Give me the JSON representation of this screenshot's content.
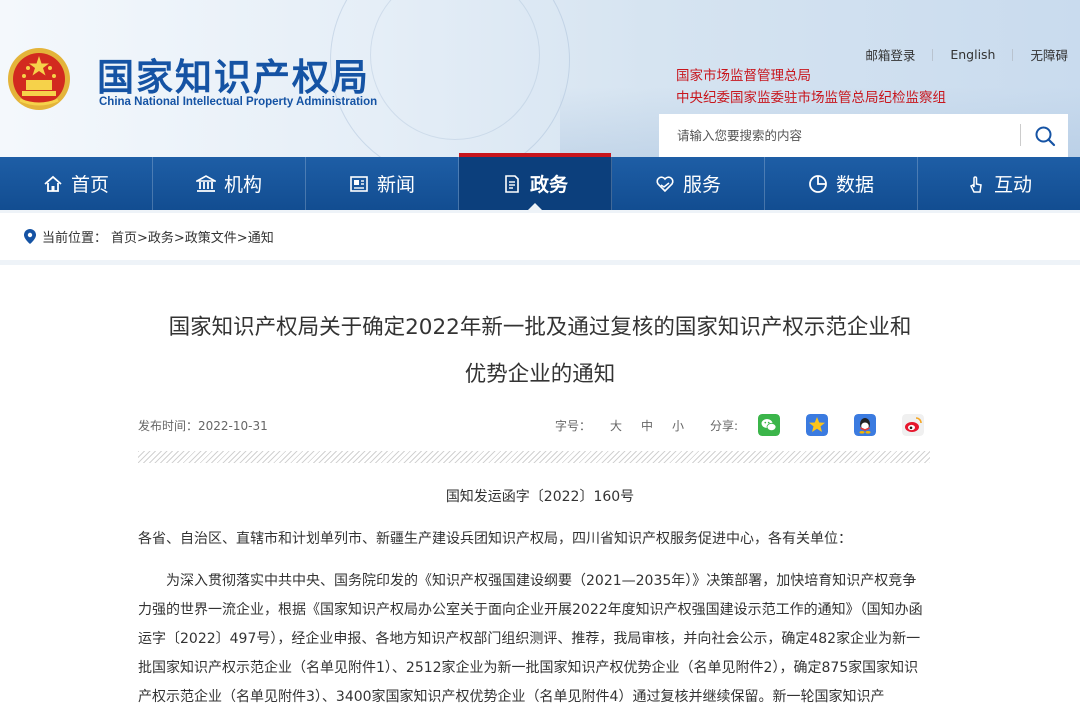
{
  "header": {
    "logo_cn": "国家知识产权局",
    "logo_en": "China National Intellectual Property Administration",
    "top_links": [
      "邮箱登录",
      "English",
      "无障碍"
    ],
    "partners": [
      "国家市场监督管理总局",
      "中央纪委国家监委驻市场监管总局纪检监察组"
    ],
    "search_placeholder": "请输入您要搜索的内容"
  },
  "nav": [
    {
      "label": "首页",
      "icon": "home-icon"
    },
    {
      "label": "机构",
      "icon": "institution-icon"
    },
    {
      "label": "新闻",
      "icon": "news-icon"
    },
    {
      "label": "政务",
      "icon": "document-icon",
      "active": true
    },
    {
      "label": "服务",
      "icon": "service-icon"
    },
    {
      "label": "数据",
      "icon": "pie-chart-icon"
    },
    {
      "label": "互动",
      "icon": "hand-touch-icon"
    }
  ],
  "breadcrumb": {
    "label": "当前位置：",
    "path": "首页>政务>政策文件>通知"
  },
  "article": {
    "title_line1": "国家知识产权局关于确定2022年新一批及通过复核的国家知识产权示范企业和",
    "title_line2": "优势企业的通知",
    "date": "发布时间：2022-10-31",
    "font_size_label": "字号：",
    "font_sizes": [
      "大",
      "中",
      "小"
    ],
    "share_label": "分享:",
    "share_icons": [
      "wechat-icon",
      "qzone-icon",
      "qq-icon",
      "weibo-icon"
    ],
    "doc_number": "国知发运函字〔2022〕160号",
    "salutation": "各省、自治区、直辖市和计划单列市、新疆生产建设兵团知识产权局，四川省知识产权服务促进中心，各有关单位：",
    "body": "为深入贯彻落实中共中央、国务院印发的《知识产权强国建设纲要（2021—2035年）》决策部署，加快培育知识产权竞争力强的世界一流企业，根据《国家知识产权局办公室关于面向企业开展2022年度知识产权强国建设示范工作的通知》（国知办函运字〔2022〕497号），经企业申报、各地方知识产权部门组织测评、推荐，我局审核，并向社会公示，确定482家企业为新一批国家知识产权示范企业（名单见附件1）、2512家企业为新一批国家知识产权优势企业（名单见附件2），确定875家国家知识产权示范企业（名单见附件3）、3400家国家知识产权优势企业（名单见附件4）通过复核并继续保留。新一轮国家知识产"
  },
  "colors": {
    "brand_blue": "#1553a4",
    "nav_blue": "#124d91",
    "accent_red": "#c8161d"
  }
}
